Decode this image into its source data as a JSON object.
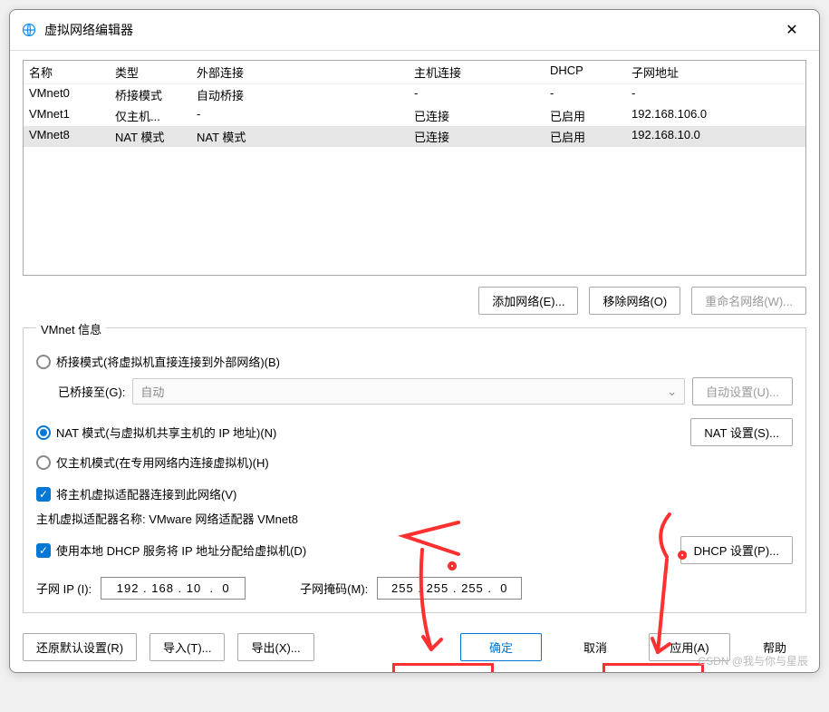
{
  "window": {
    "title": "虚拟网络编辑器"
  },
  "table": {
    "headers": [
      "名称",
      "类型",
      "外部连接",
      "主机连接",
      "DHCP",
      "子网地址"
    ],
    "rows": [
      {
        "name": "VMnet0",
        "type": "桥接模式",
        "ext": "自动桥接",
        "host": "-",
        "dhcp": "-",
        "subnet": "-",
        "selected": false
      },
      {
        "name": "VMnet1",
        "type": "仅主机...",
        "ext": "-",
        "host": "已连接",
        "dhcp": "已启用",
        "subnet": "192.168.106.0",
        "selected": false
      },
      {
        "name": "VMnet8",
        "type": "NAT 模式",
        "ext": "NAT 模式",
        "host": "已连接",
        "dhcp": "已启用",
        "subnet": "192.168.10.0",
        "selected": true
      }
    ]
  },
  "buttons": {
    "add_network": "添加网络(E)...",
    "remove_network": "移除网络(O)",
    "rename_network": "重命名网络(W)...",
    "auto_settings": "自动设置(U)...",
    "nat_settings": "NAT 设置(S)...",
    "dhcp_settings": "DHCP 设置(P)...",
    "restore_defaults": "还原默认设置(R)",
    "import": "导入(T)...",
    "export": "导出(X)...",
    "ok": "确定",
    "cancel": "取消",
    "apply": "应用(A)",
    "help": "帮助"
  },
  "info": {
    "legend": "VMnet 信息",
    "bridged_label": "桥接模式(将虚拟机直接连接到外部网络)(B)",
    "bridged_to_label": "已桥接至(G):",
    "bridged_to_value": "自动",
    "nat_label": "NAT 模式(与虚拟机共享主机的 IP 地址)(N)",
    "hostonly_label": "仅主机模式(在专用网络内连接虚拟机)(H)",
    "connect_host_label": "将主机虚拟适配器连接到此网络(V)",
    "adapter_name_label": "主机虚拟适配器名称: VMware 网络适配器 VMnet8",
    "use_dhcp_label": "使用本地 DHCP 服务将 IP 地址分配给虚拟机(D)",
    "subnet_ip_label": "子网 IP (I):",
    "subnet_ip_value": "192 . 168 . 10  .  0",
    "subnet_mask_label": "子网掩码(M):",
    "subnet_mask_value": "255 . 255 . 255 .  0"
  },
  "watermark": "CSDN @我与你与星辰"
}
